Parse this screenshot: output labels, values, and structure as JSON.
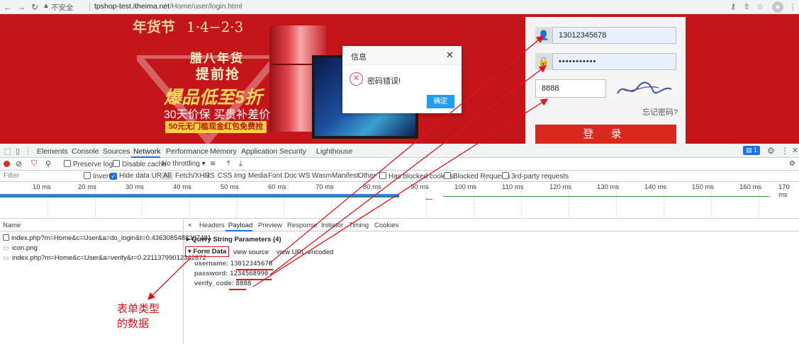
{
  "browser": {
    "insecure_label": "不安全",
    "url_host": "tpshop-test.itheima.net",
    "url_path": "/Home/user/login.html"
  },
  "page": {
    "banner": {
      "logo_text": "年货节",
      "date_text": "1·4−2·3",
      "line1": "腊八年货",
      "line2": "提前抢",
      "line3": "爆品低至5折",
      "line4": "30天价保 买贵补差价",
      "line5": "50元无门槛现金红包免费抢"
    },
    "login": {
      "username_value": "13012345678",
      "password_value": "•••••••••••",
      "verify_code_value": "8888",
      "forgot_label": "忘记密码?",
      "login_button": "登 录"
    },
    "modal": {
      "title": "信息",
      "message": "密码错误!",
      "ok_label": "确定",
      "close_glyph": "✕"
    }
  },
  "devtools": {
    "tabs": [
      "Elements",
      "Console",
      "Sources",
      "Network",
      "Performance",
      "Memory",
      "Application",
      "Security",
      "Lighthouse"
    ],
    "issues_count": "1",
    "toolbar": {
      "preserve_log": "Preserve log",
      "disable_cache": "Disable cache",
      "throttling": "No throttling"
    },
    "filter": {
      "placeholder": "Filter",
      "invert": "Invert",
      "hide_data_urls": "Hide data URLs",
      "types": [
        "All",
        "Fetch/XHR",
        "JS",
        "CSS",
        "Img",
        "Media",
        "Font",
        "Doc",
        "WS",
        "Wasm",
        "Manifest",
        "Other"
      ],
      "blocked_cookies": "Has blocked cookies",
      "blocked_requests": "Blocked Requests",
      "third_party": "3rd-party requests"
    },
    "timeline_ticks": [
      "10 ms",
      "20 ms",
      "30 ms",
      "40 ms",
      "50 ms",
      "60 ms",
      "70 ms",
      "80 ms",
      "90 ms",
      "100 ms",
      "110 ms",
      "120 ms",
      "130 ms",
      "140 ms",
      "150 ms",
      "160 ms",
      "170 ms"
    ],
    "name_header": "Name",
    "requests": [
      "index.php?m=Home&c=User&a=do_login&t=0.4363085488307481",
      "icon.png",
      "index.php?m=Home&c=User&a=verify&r=0.22113799012342872"
    ],
    "detail_tabs": [
      "Headers",
      "Payload",
      "Preview",
      "Response",
      "Initiator",
      "Timing",
      "Cookies"
    ],
    "detail_close": "×",
    "query_string": "Query String Parameters (4)",
    "form_data": "Form Data",
    "view_source": "view source",
    "view_url_encoded": "view URL-encoded",
    "fields": [
      {
        "key": "username:",
        "value": "13012345678"
      },
      {
        "key": "password:",
        "value": "1234568990"
      },
      {
        "key": "verify_code:",
        "value": "8888"
      }
    ]
  },
  "annotation": {
    "line1": "表单类型",
    "line2": "的数据",
    "color": "#e3131b"
  }
}
